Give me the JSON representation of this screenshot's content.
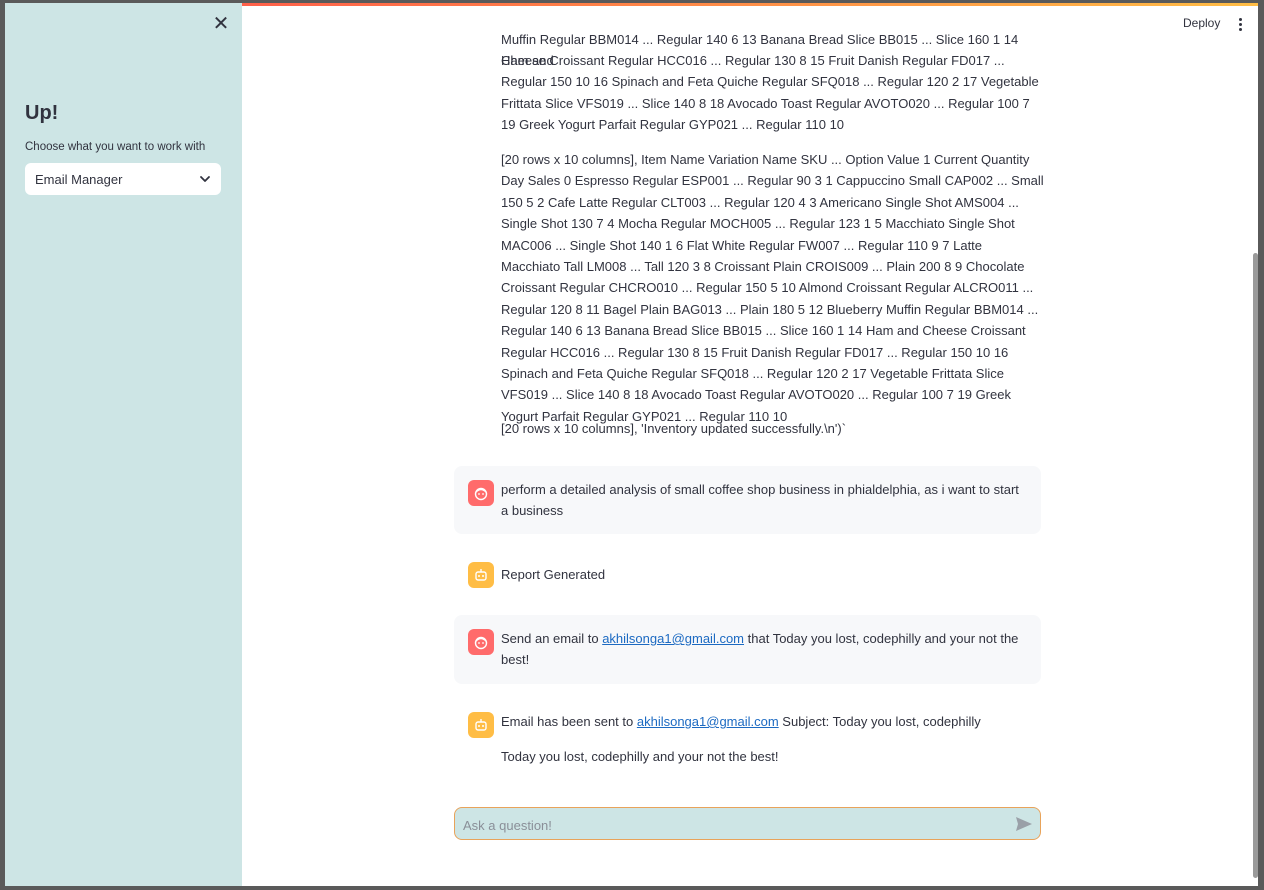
{
  "sidebar": {
    "close_glyph": "✕",
    "title": "Up!",
    "choose_label": "Choose what you want to work with",
    "selected_option": "Email Manager"
  },
  "header": {
    "deploy_label": "Deploy"
  },
  "chat": {
    "partial_top_1": "Muffin Regular BBM014 ... Regular 140 6 13 Banana Bread Slice BB015 ... Slice 160 1 14 Ham and",
    "partial_top_2": "Cheese Croissant Regular HCC016 ... Regular 130 8 15 Fruit Danish Regular FD017 ... Regular 150 10 16 Spinach and Feta Quiche Regular SFQ018 ... Regular 120 2 17 Vegetable Frittata Slice VFS019 ... Slice 140 8 18 Avocado Toast Regular AVOTO020 ... Regular 100 7 19 Greek Yogurt Parfait Regular GYP021 ... Regular 110 10",
    "paragraph_2": "[20 rows x 10 columns], Item Name Variation Name SKU ... Option Value 1 Current Quantity Day Sales 0 Espresso Regular ESP001 ... Regular 90 3 1 Cappuccino Small CAP002 ... Small 150 5 2 Cafe Latte Regular CLT003 ... Regular 120 4 3 Americano Single Shot AMS004 ... Single Shot 130 7 4 Mocha Regular MOCH005 ... Regular 123 1 5 Macchiato Single Shot MAC006 ... Single Shot 140 1 6 Flat White Regular FW007 ... Regular 110 9 7 Latte Macchiato Tall LM008 ... Tall 120 3 8 Croissant Plain CROIS009 ... Plain 200 8 9 Chocolate Croissant Regular CHCRO010 ... Regular 150 5 10 Almond Croissant Regular ALCRO011 ... Regular 120 8 11 Bagel Plain BAG013 ... Plain 180 5 12 Blueberry Muffin Regular BBM014 ... Regular 140 6 13 Banana Bread Slice BB015 ... Slice 160 1 14 Ham and Cheese Croissant Regular HCC016 ... Regular 130 8 15 Fruit Danish Regular FD017 ... Regular 150 10 16 Spinach and Feta Quiche Regular SFQ018 ... Regular 120 2 17 Vegetable Frittata Slice VFS019 ... Slice 140 8 18 Avocado Toast Regular AVOTO020 ... Regular 100 7 19 Greek Yogurt Parfait Regular GYP021 ... Regular 110 10",
    "paragraph_3": "[20 rows x 10 columns], 'Inventory updated successfully.\\n')`",
    "user_msg_1": "perform a detailed analysis of small coffee shop business in phialdelphia, as i want to start a business",
    "bot_msg_1": "Report Generated",
    "user_msg_2": {
      "before": "Send an email to ",
      "email": "akhilsonga1@gmail.com",
      "after": " that Today you lost, codephilly and your not the best!"
    },
    "bot_msg_2": {
      "before": "Email has been sent to ",
      "email": "akhilsonga1@gmail.com",
      "after": " Subject: Today you lost, codephilly",
      "body": "Today you lost, codephilly and your not the best!"
    }
  },
  "input": {
    "placeholder": "Ask a question!",
    "value": ""
  },
  "icons": {
    "close": "close-icon",
    "chevron": "chevron-down-icon",
    "kebab": "kebab-menu-icon",
    "user_avatar": "user-face-icon",
    "bot_avatar": "robot-icon",
    "send": "send-icon"
  },
  "colors": {
    "sidebar_bg": "#cde5e5",
    "user_avatar": "#ff6b6b",
    "bot_avatar": "#ffbd45",
    "link": "#1c6ac2",
    "input_border": "#e8a35a"
  }
}
